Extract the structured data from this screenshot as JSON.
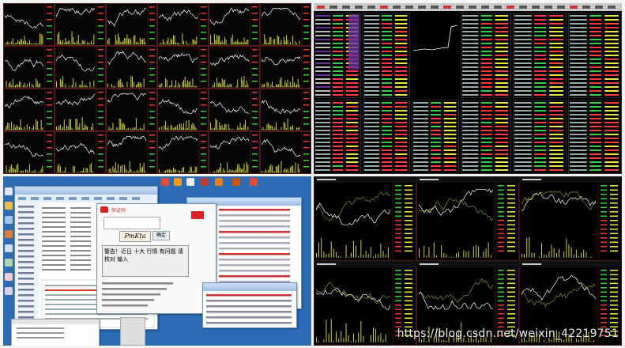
{
  "screens": {
    "top_left": {
      "grid_rows": 4,
      "grid_cols": 6,
      "line_color": "#ffffff",
      "volume_color": "#e8e83a",
      "frame_color": "#8b2525"
    },
    "top_right": {
      "accent_purple": "#6b2fa0",
      "accent_red": "#ff3b3b",
      "accent_green": "#35d04a"
    },
    "bottom_left": {
      "desktop_color": "#2b6cb5",
      "popup": {
        "title": "验证码",
        "captcha": "PmKta",
        "notice": "警告！近日 十大 行情 有问题 请 核对 输入",
        "confirm_label": "确定"
      }
    },
    "bottom_right": {
      "grid_rows": 2,
      "grid_cols": 3,
      "line_color": "#ffffff",
      "volume_color": "#e8e83a"
    }
  },
  "watermark": "https://blog.csdn.net/weixin_42219751"
}
